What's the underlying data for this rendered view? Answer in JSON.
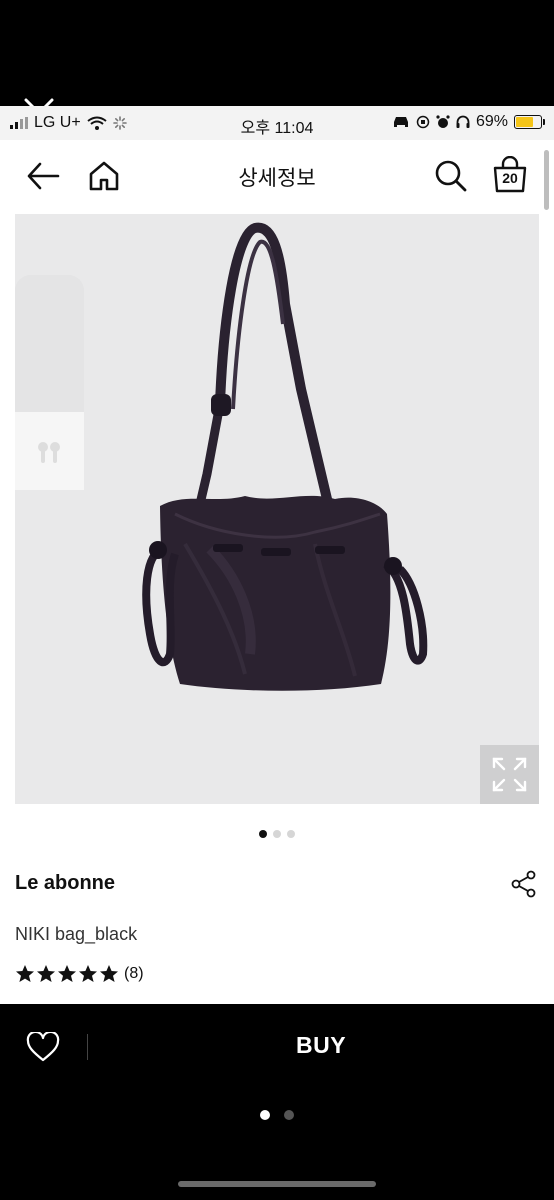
{
  "status_bar": {
    "carrier": "LG U+",
    "time": "오후 11:04",
    "battery": "69%",
    "battery_color": "#f5c518"
  },
  "overlay": {
    "close_icon": "close-icon"
  },
  "header": {
    "title": "상세정보",
    "cart_count": "20",
    "icons": [
      "back-arrow-icon",
      "home-icon",
      "search-icon",
      "cart-bag-icon"
    ]
  },
  "product": {
    "brand": "Le abonne",
    "name": "NIKI bag_black",
    "rating_stars": 5,
    "review_count": "(8)",
    "image_indicator": {
      "count": 3,
      "active": 0
    }
  },
  "bottom_bar": {
    "buy_label": "BUY",
    "icons": [
      "heart-icon"
    ]
  },
  "pager": {
    "count": 2,
    "active": 0
  }
}
